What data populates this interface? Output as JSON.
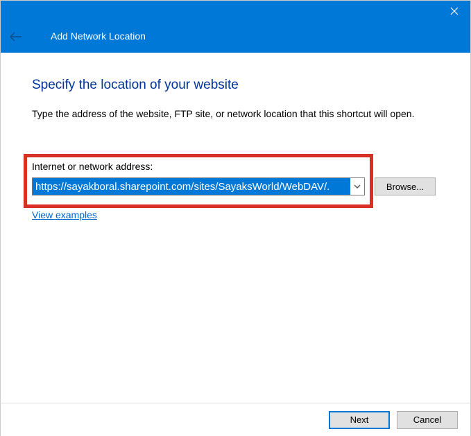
{
  "titlebar": {
    "title": "Add Network Location"
  },
  "heading": "Specify the location of your website",
  "description": "Type the address of the website, FTP site, or network location that this shortcut will open.",
  "field": {
    "label": "Internet or network address:",
    "value": "https://sayakboral.sharepoint.com/sites/SayaksWorld/WebDAV/.",
    "browse_label": "Browse..."
  },
  "examples_link": "View examples",
  "footer": {
    "next_label": "Next",
    "cancel_label": "Cancel"
  },
  "colors": {
    "accent": "#0078d7",
    "heading": "#003399",
    "highlight_border": "#d93025",
    "link": "#0066cc"
  }
}
